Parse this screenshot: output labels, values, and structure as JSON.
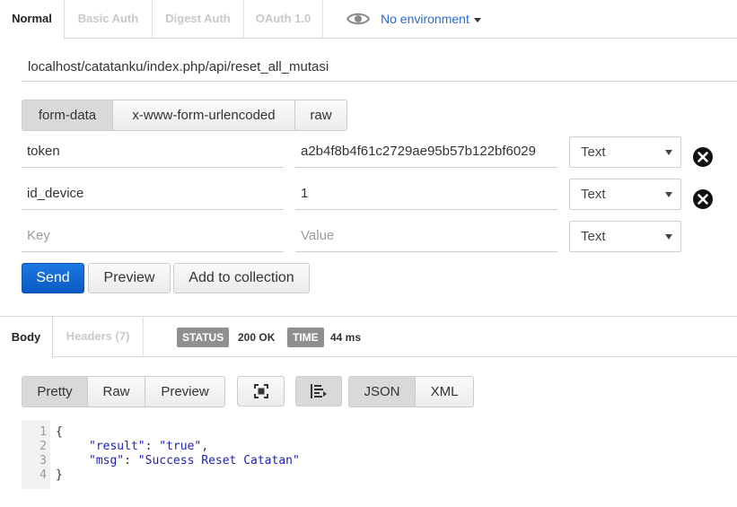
{
  "auth_tabs": [
    {
      "label": "Normal",
      "active": true
    },
    {
      "label": "Basic Auth",
      "active": false
    },
    {
      "label": "Digest Auth",
      "active": false
    },
    {
      "label": "OAuth 1.0",
      "active": false
    }
  ],
  "environment": {
    "label": "No environment",
    "icon": "eye-icon"
  },
  "request": {
    "url": "localhost/catatanku/index.php/api/reset_all_mutasi"
  },
  "body_modes": [
    {
      "label": "form-data",
      "active": true
    },
    {
      "label": "x-www-form-urlencoded",
      "active": false
    },
    {
      "label": "raw",
      "active": false
    }
  ],
  "params": [
    {
      "key": "token",
      "value": "a2b4f8b4f61c2729ae95b57b122bf6029",
      "type": "Text"
    },
    {
      "key": "id_device",
      "value": "1",
      "type": "Text"
    }
  ],
  "new_param": {
    "key_placeholder": "Key",
    "value_placeholder": "Value",
    "type": "Text"
  },
  "actions": {
    "send": "Send",
    "preview": "Preview",
    "add_to_collection": "Add to collection"
  },
  "response": {
    "tabs": [
      {
        "label": "Body",
        "active": true
      },
      {
        "label": "Headers (7)",
        "active": false
      }
    ],
    "status_label": "STATUS",
    "status_value": "200 OK",
    "time_label": "TIME",
    "time_value": "44 ms",
    "view_modes": [
      {
        "label": "Pretty",
        "active": true
      },
      {
        "label": "Raw",
        "active": false
      },
      {
        "label": "Preview",
        "active": false
      }
    ],
    "formats": [
      {
        "label": "JSON",
        "active": true
      },
      {
        "label": "XML",
        "active": false
      }
    ],
    "code": {
      "line_numbers": [
        "1",
        "2",
        "3",
        "4"
      ],
      "open": "{",
      "close": "}",
      "entries": [
        {
          "key": "\"result\"",
          "value": "\"true\"",
          "sep": ": ",
          "trail": ","
        },
        {
          "key": "\"msg\"",
          "value": "\"Success Reset Catatan\"",
          "sep": ": ",
          "trail": ""
        }
      ]
    }
  },
  "colors": {
    "accent": "#2a6bd1",
    "send_button": "#0a59c2",
    "tag_bg": "#8f8f8f"
  }
}
